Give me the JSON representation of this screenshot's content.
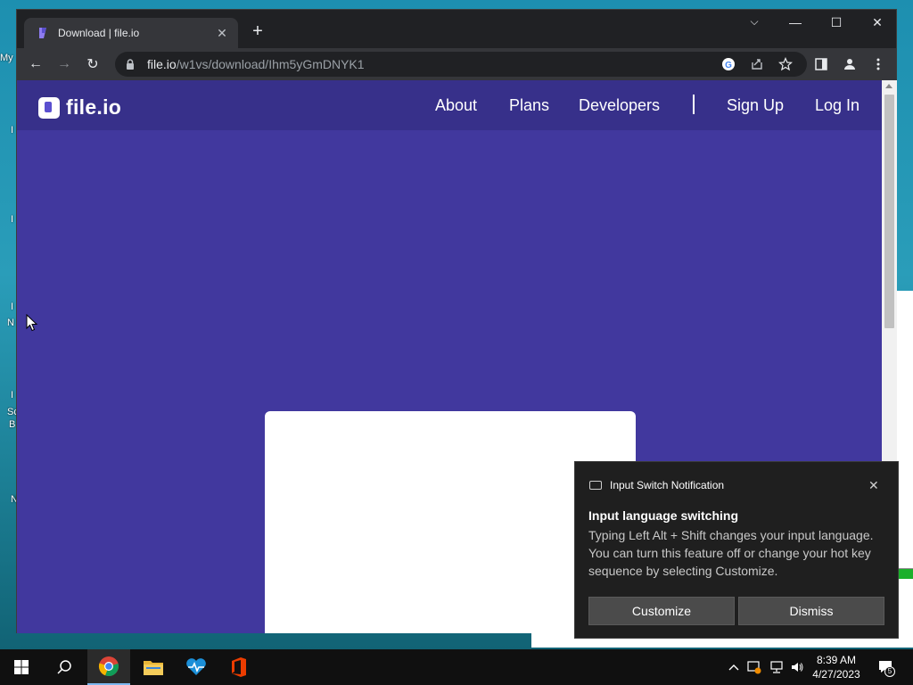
{
  "desktop": {
    "fragments": [
      "My",
      "I",
      "I",
      "I",
      "N",
      "I",
      "Sc",
      "B",
      "N"
    ]
  },
  "browser": {
    "tab": {
      "title": "Download | file.io",
      "close": "✕"
    },
    "new_tab": "+",
    "window_controls": {
      "tabsearch": "⌵",
      "minimize": "—",
      "maximize": "☐",
      "close": "✕"
    },
    "toolbar": {
      "back": "←",
      "forward": "→",
      "reload": "↻",
      "url_host": "file.io",
      "url_path": "/w1vs/download/Ihm5yGmDNYK1"
    }
  },
  "site": {
    "logo_text": "file.io",
    "nav": {
      "about": "About",
      "plans": "Plans",
      "developers": "Developers",
      "signup": "Sign Up",
      "login": "Log In"
    }
  },
  "notification": {
    "app_name": "Input Switch Notification",
    "title": "Input language switching",
    "body": "Typing Left Alt + Shift changes your input language. You can turn this feature off or change your hot key sequence by selecting Customize.",
    "customize": "Customize",
    "dismiss": "Dismiss",
    "close": "✕"
  },
  "taskbar": {
    "time": "8:39 AM",
    "date": "4/27/2023",
    "notification_count": "5"
  },
  "colors": {
    "site_bg": "#41389e",
    "site_nav": "#37308a",
    "chrome_dark": "#202124",
    "chrome_toolbar": "#35363a"
  }
}
